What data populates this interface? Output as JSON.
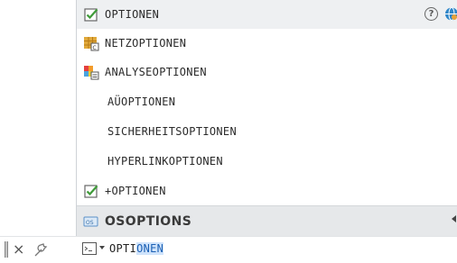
{
  "suggestions": {
    "items": [
      {
        "label": "OPTIONEN",
        "icon": "checkbox-check-icon"
      },
      {
        "label": "NETZOPTIONEN",
        "icon": "net-options-icon"
      },
      {
        "label": "ANALYSEOPTIONEN",
        "icon": "analysis-options-icon"
      },
      {
        "label": "AÜOPTIONEN",
        "icon": ""
      },
      {
        "label": "SICHERHEITSOPTIONEN",
        "icon": ""
      },
      {
        "label": "HYPERLINKOPTIONEN",
        "icon": ""
      },
      {
        "label": "+OPTIONEN",
        "icon": "checkbox-check-icon"
      }
    ],
    "help_symbol": "?",
    "system_variable": {
      "label": "OSOPTIONS",
      "icon": "system-variable-icon"
    }
  },
  "command_line": {
    "close_symbol": "×",
    "typed_prefix": "OPTI",
    "autocomplete_suffix": "ONEN"
  },
  "colors": {
    "selection_highlight": "#cfe3fb",
    "selection_text": "#1a5fb4",
    "check_green": "#3f9b39"
  }
}
